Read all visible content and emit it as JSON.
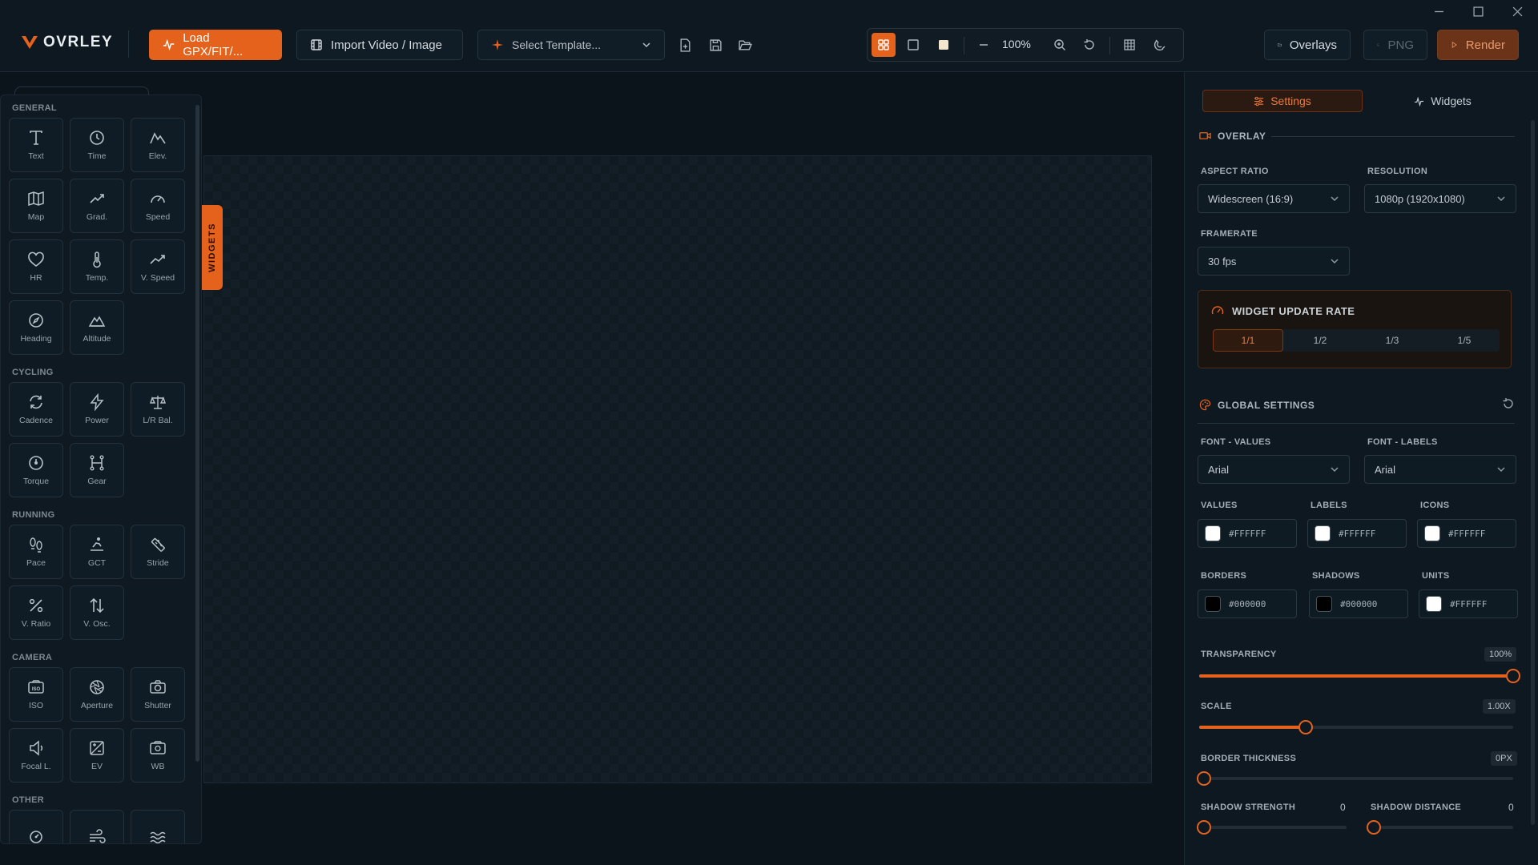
{
  "app": {
    "logo_text": "OVRLEY"
  },
  "toolbar": {
    "load_label": "Load GPX/FIT/...",
    "import_label": "Import Video / Image",
    "template_placeholder": "Select Template...",
    "zoom": "100%",
    "overlays_label": "Overlays",
    "png_label": "PNG",
    "render_label": "Render"
  },
  "widgets_tab_label": "WIDGETS",
  "widget_sections": [
    {
      "title": "GENERAL",
      "items": [
        {
          "label": "Text",
          "icon": "text-icon"
        },
        {
          "label": "Time",
          "icon": "clock-icon"
        },
        {
          "label": "Elev.",
          "icon": "elevation-icon"
        },
        {
          "label": "Map",
          "icon": "map-icon"
        },
        {
          "label": "Grad.",
          "icon": "gradient-icon"
        },
        {
          "label": "Speed",
          "icon": "speedometer-icon"
        },
        {
          "label": "HR",
          "icon": "heart-icon"
        },
        {
          "label": "Temp.",
          "icon": "thermometer-icon"
        },
        {
          "label": "V. Speed",
          "icon": "trend-up-icon"
        },
        {
          "label": "Heading",
          "icon": "compass-icon"
        },
        {
          "label": "Altitude",
          "icon": "mountain-icon"
        }
      ]
    },
    {
      "title": "CYCLING",
      "items": [
        {
          "label": "Cadence",
          "icon": "refresh-icon"
        },
        {
          "label": "Power",
          "icon": "bolt-icon"
        },
        {
          "label": "L/R Bal.",
          "icon": "scale-icon"
        },
        {
          "label": "Torque",
          "icon": "torque-icon"
        },
        {
          "label": "Gear",
          "icon": "gear-shift-icon"
        }
      ]
    },
    {
      "title": "RUNNING",
      "items": [
        {
          "label": "Pace",
          "icon": "footprints-icon"
        },
        {
          "label": "GCT",
          "icon": "ground-contact-icon"
        },
        {
          "label": "Stride",
          "icon": "ruler-icon"
        },
        {
          "label": "V. Ratio",
          "icon": "percent-icon"
        },
        {
          "label": "V. Osc.",
          "icon": "up-down-arrows-icon"
        }
      ]
    },
    {
      "title": "CAMERA",
      "items": [
        {
          "label": "ISO",
          "icon": "iso-icon"
        },
        {
          "label": "Aperture",
          "icon": "aperture-icon"
        },
        {
          "label": "Shutter",
          "icon": "camera-icon"
        },
        {
          "label": "Focal L.",
          "icon": "focal-icon"
        },
        {
          "label": "EV",
          "icon": "exposure-icon"
        },
        {
          "label": "WB",
          "icon": "white-balance-icon"
        }
      ]
    },
    {
      "title": "OTHER",
      "items": [
        {
          "label": "",
          "icon": "gauge-icon"
        },
        {
          "label": "",
          "icon": "wind-icon"
        },
        {
          "label": "",
          "icon": "waves-icon"
        }
      ]
    }
  ],
  "right_panel": {
    "tabs": {
      "settings": "Settings",
      "widgets": "Widgets"
    },
    "overlay_heading": "OVERLAY",
    "aspect_ratio": {
      "label": "ASPECT RATIO",
      "value": "Widescreen (16:9)"
    },
    "resolution": {
      "label": "RESOLUTION",
      "value": "1080p (1920x1080)"
    },
    "framerate": {
      "label": "FRAMERATE",
      "value": "30 fps"
    },
    "update_rate": {
      "title": "WIDGET UPDATE RATE",
      "options": [
        "1/1",
        "1/2",
        "1/3",
        "1/5"
      ],
      "selected": "1/1"
    },
    "global_heading": "GLOBAL SETTINGS",
    "font_values": {
      "label": "FONT - VALUES",
      "value": "Arial"
    },
    "font_labels": {
      "label": "FONT - LABELS",
      "value": "Arial"
    },
    "colors": {
      "values": {
        "label": "VALUES",
        "value": "#FFFFFF",
        "color": "#ffffff"
      },
      "labels": {
        "label": "LABELS",
        "value": "#FFFFFF",
        "color": "#ffffff"
      },
      "icons": {
        "label": "ICONS",
        "value": "#FFFFFF",
        "color": "#ffffff"
      },
      "borders": {
        "label": "BORDERS",
        "value": "#000000",
        "color": "#000000"
      },
      "shadows": {
        "label": "SHADOWS",
        "value": "#000000",
        "color": "#000000"
      },
      "units": {
        "label": "UNITS",
        "value": "#FFFFFF",
        "color": "#ffffff"
      }
    },
    "transparency": {
      "label": "TRANSPARENCY",
      "display": "100%",
      "fraction": 1.0
    },
    "scale": {
      "label": "SCALE",
      "display": "1.00X",
      "fraction": 0.34
    },
    "border_thickness": {
      "label": "BORDER THICKNESS",
      "display": "0PX",
      "fraction": 0.0
    },
    "shadow_strength": {
      "label": "SHADOW STRENGTH",
      "display": "0",
      "fraction": 0.0
    },
    "shadow_distance": {
      "label": "SHADOW DISTANCE",
      "display": "0",
      "fraction": 0.0
    }
  },
  "theme": {
    "accent": "#e5621d"
  }
}
